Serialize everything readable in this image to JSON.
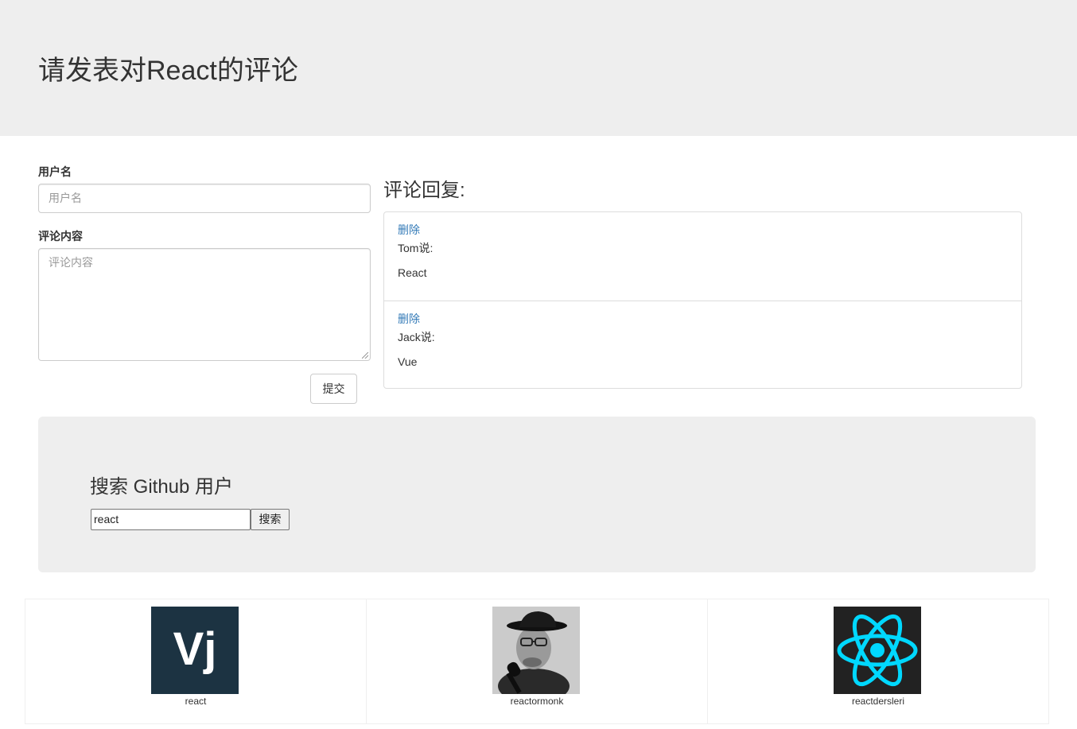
{
  "header": {
    "title": "请发表对React的评论"
  },
  "form": {
    "username_label": "用户名",
    "username_placeholder": "用户名",
    "content_label": "评论内容",
    "content_placeholder": "评论内容",
    "submit_label": "提交"
  },
  "replies": {
    "title": "评论回复:",
    "items": [
      {
        "delete_label": "删除",
        "author": "Tom说:",
        "content": "React"
      },
      {
        "delete_label": "删除",
        "author": "Jack说:",
        "content": "Vue"
      }
    ]
  },
  "search": {
    "title": "搜索 Github 用户",
    "input_value": "react",
    "button_label": "搜索"
  },
  "users": [
    {
      "name": "react",
      "avatar": "vj-logo"
    },
    {
      "name": "reactormonk",
      "avatar": "person-photo"
    },
    {
      "name": "reactdersleri",
      "avatar": "react-atom-logo"
    }
  ],
  "colors": {
    "jumbotron_bg": "#eeeeee",
    "link": "#337ab7",
    "react_cyan": "#00d8ff",
    "vj_bg": "#1c3342"
  }
}
